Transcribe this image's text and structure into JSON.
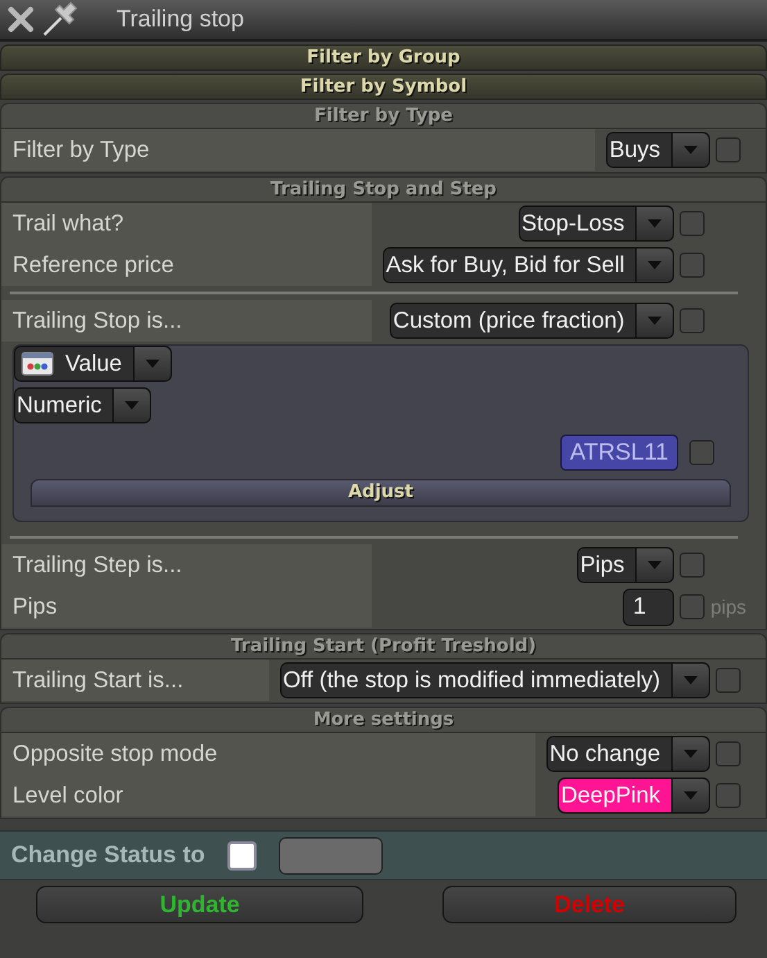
{
  "window": {
    "title": "Trailing stop"
  },
  "sections": [
    {
      "kind": "collapsed",
      "title": "Filter by Group"
    },
    {
      "kind": "collapsed",
      "title": "Filter by Symbol"
    },
    {
      "kind": "group",
      "title": "Filter by Type",
      "rows": [
        {
          "kind": "select",
          "label": "Filter by Type",
          "value": "Buys",
          "checked": false
        }
      ]
    },
    {
      "kind": "group",
      "title": "Trailing Stop and Step",
      "rows": [
        {
          "kind": "select",
          "label": "Trail what?",
          "value": "Stop-Loss",
          "checked": false
        },
        {
          "kind": "select",
          "label": "Reference price",
          "value": "Ask for Buy, Bid for Sell",
          "checked": false
        },
        {
          "kind": "divider"
        },
        {
          "kind": "select",
          "label": "Trailing Stop is...",
          "value": "Custom (price fraction)",
          "checked": false
        },
        {
          "kind": "panel",
          "source": "Value",
          "format": "Numeric",
          "field": "ATRSL11",
          "checked": false,
          "button": "Adjust"
        },
        {
          "kind": "divider"
        },
        {
          "kind": "select",
          "label": "Trailing Step is...",
          "value": "Pips",
          "checked": false
        },
        {
          "kind": "number",
          "label": "Pips",
          "value": "1",
          "checked": false,
          "unit": "pips"
        }
      ]
    },
    {
      "kind": "group",
      "title": "Trailing Start (Profit Treshold)",
      "rows": [
        {
          "kind": "select",
          "label": "Trailing Start is...",
          "value": "Off (the stop is modified immediately)",
          "checked": false
        }
      ]
    },
    {
      "kind": "group",
      "title": "More settings",
      "rows": [
        {
          "kind": "select",
          "label": "Opposite stop mode",
          "value": "No change",
          "checked": false
        },
        {
          "kind": "select",
          "label": "Level color",
          "value": "DeepPink",
          "checked": false,
          "color": "#ff1493"
        }
      ]
    }
  ],
  "status": {
    "label": "Change Status to",
    "checked": false
  },
  "buttons": [
    {
      "label": "Update",
      "color": "#2fb52f"
    },
    {
      "label": "Delete",
      "color": "#d40000"
    }
  ]
}
